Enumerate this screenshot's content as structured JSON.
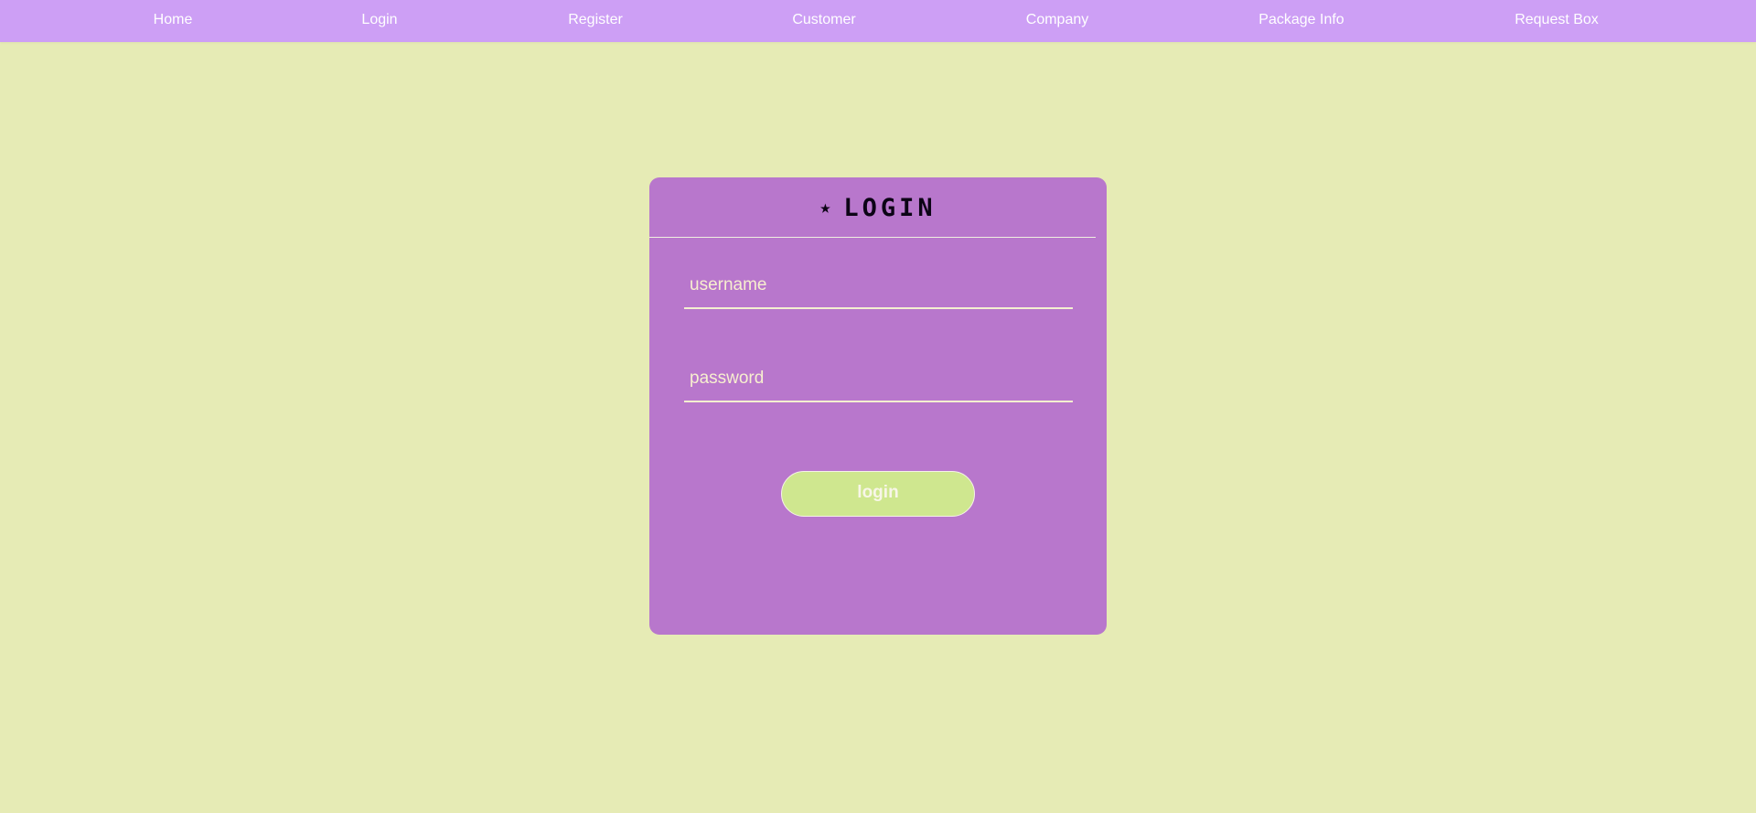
{
  "nav": {
    "items": [
      {
        "label": "Home"
      },
      {
        "label": "Login"
      },
      {
        "label": "Register"
      },
      {
        "label": "Customer"
      },
      {
        "label": "Company"
      },
      {
        "label": "Package Info"
      },
      {
        "label": "Request Box"
      }
    ]
  },
  "login_card": {
    "title_icon": "star-icon",
    "title_star": "★",
    "title": "LOGIN",
    "username": {
      "value": "",
      "placeholder": "username"
    },
    "password": {
      "value": "",
      "placeholder": "password"
    },
    "submit_label": "login"
  },
  "colors": {
    "background": "#e6ebb5",
    "navbar": "#cd9ff5",
    "card": "#b877cc",
    "button": "#cfe78f",
    "title_text": "#0c0416"
  }
}
